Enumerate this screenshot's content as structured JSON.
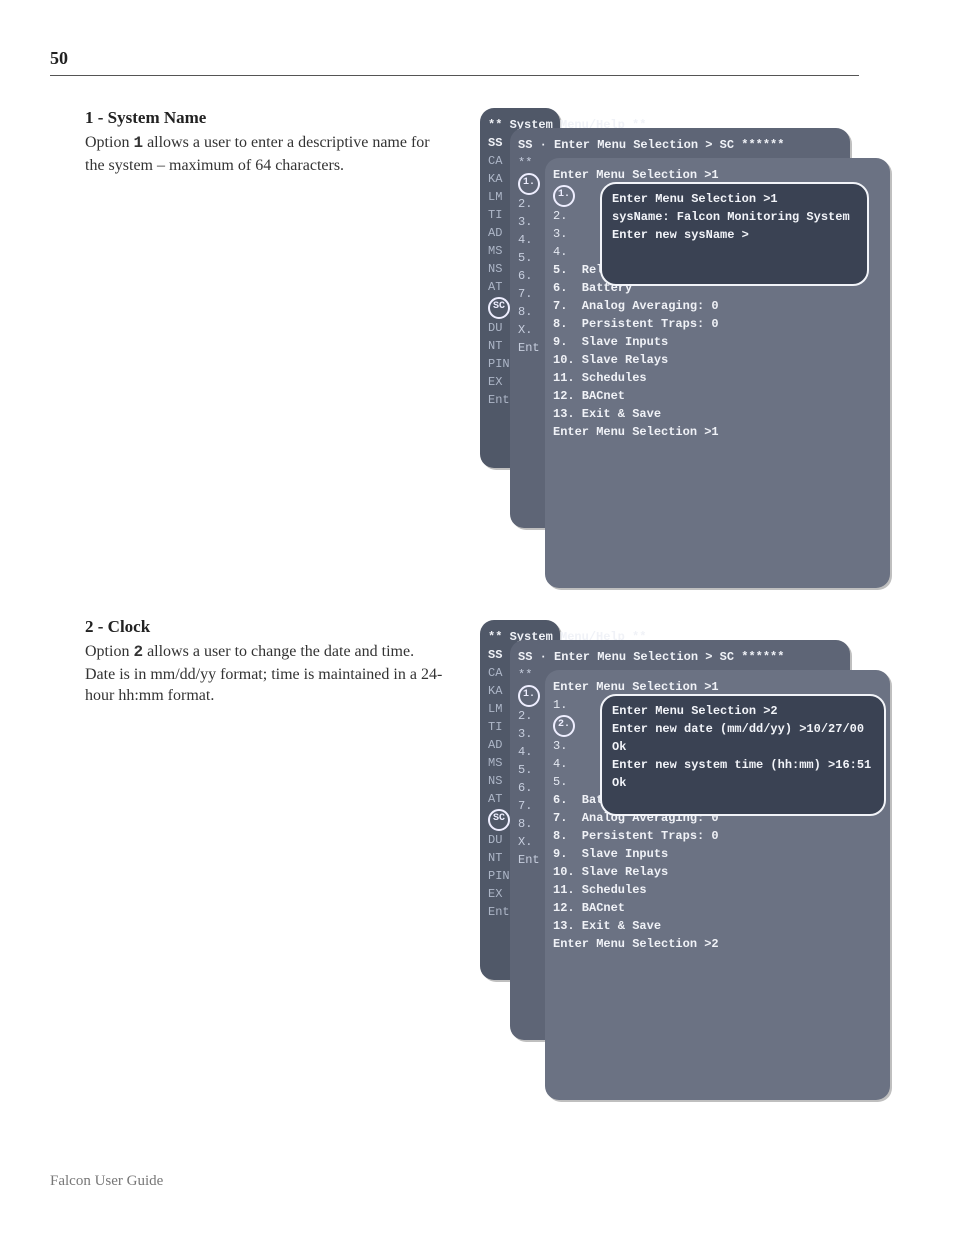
{
  "page_number": "50",
  "footer": "Falcon User Guide",
  "section1": {
    "title": "1 - System Name",
    "body_pre": "Option ",
    "body_bold": "1",
    "body_post": " allows a user to enter a descriptive name for the system – maximum of 64 characters."
  },
  "section2": {
    "title": "2 - Clock",
    "body_pre": "Option ",
    "body_bold": "2",
    "body_post": " allows a user to change the date and time. Date is in mm/dd/yy format; time is maintained in a 24-hour hh:mm format."
  },
  "terminal_common": {
    "header": "** System Menu/Help **",
    "ss_line": "SS · Enter Menu Selection > SC ******",
    "ca_label": "CA ·",
    "ca_rest": "**  Enter Menu Selection >1",
    "back_rows": [
      "SS ·",
      "CA ·",
      "KA ·",
      "LM ·",
      "TI ·",
      "AD ·",
      "MS ·",
      "NS ·",
      "AT ·",
      "SC",
      "DU ·",
      "NT ·",
      "PIN(",
      "EX ·",
      "",
      "Enter Me"
    ],
    "mid_rows_numbers": [
      "**",
      "",
      "2.",
      "3.",
      "4.",
      "5.",
      "6.",
      "7.",
      "8.",
      "X.",
      "Ent",
      "",
      "",
      ""
    ],
    "mid_sel1": "1.",
    "mid_syst": "Syst"
  },
  "t1": {
    "panel_c_lines": [
      "Enter Menu Selection >1",
      "",
      "",
      "",
      "",
      "5.  Relays",
      "6.  Battery",
      "7.  Analog Averaging: 0",
      "8.  Persistent Traps: 0",
      "9.  Slave Inputs",
      "10. Slave Relays",
      "11. Schedules",
      "12. BACnet",
      "13. Exit & Save",
      "Enter Menu Selection >1"
    ],
    "panel_c_nums": [
      "",
      "",
      "2.",
      "3.",
      "4.",
      "5.",
      "6.",
      "7.",
      "8.",
      "X.",
      "Ent"
    ],
    "panel_c_one": "1.",
    "overlay": [
      "Enter Menu Selection >1",
      "sysName: Falcon Monitoring System",
      "Enter new sysName >"
    ]
  },
  "t2": {
    "panel_c_lines": [
      "Enter Menu Selection >1",
      "",
      "",
      "",
      "",
      "",
      "6.  Battery",
      "7.  Analog Averaging: 0",
      "8.  Persistent Traps: 0",
      "9.  Slave Inputs",
      "10. Slave Relays",
      "11. Schedules",
      "12. BACnet",
      "13. Exit & Save",
      "Enter Menu Selection >2"
    ],
    "panel_c_nums": [
      "",
      "1.",
      "",
      "3.",
      "4.",
      "5.",
      "6.",
      "7.",
      "8.",
      "X.",
      "Ent"
    ],
    "panel_c_two": "2.",
    "overlay": [
      "Enter Menu Selection >2",
      "Enter new date (mm/dd/yy) >10/27/00",
      "Ok",
      "Enter new system time (hh:mm) >16:51",
      "Ok"
    ]
  }
}
